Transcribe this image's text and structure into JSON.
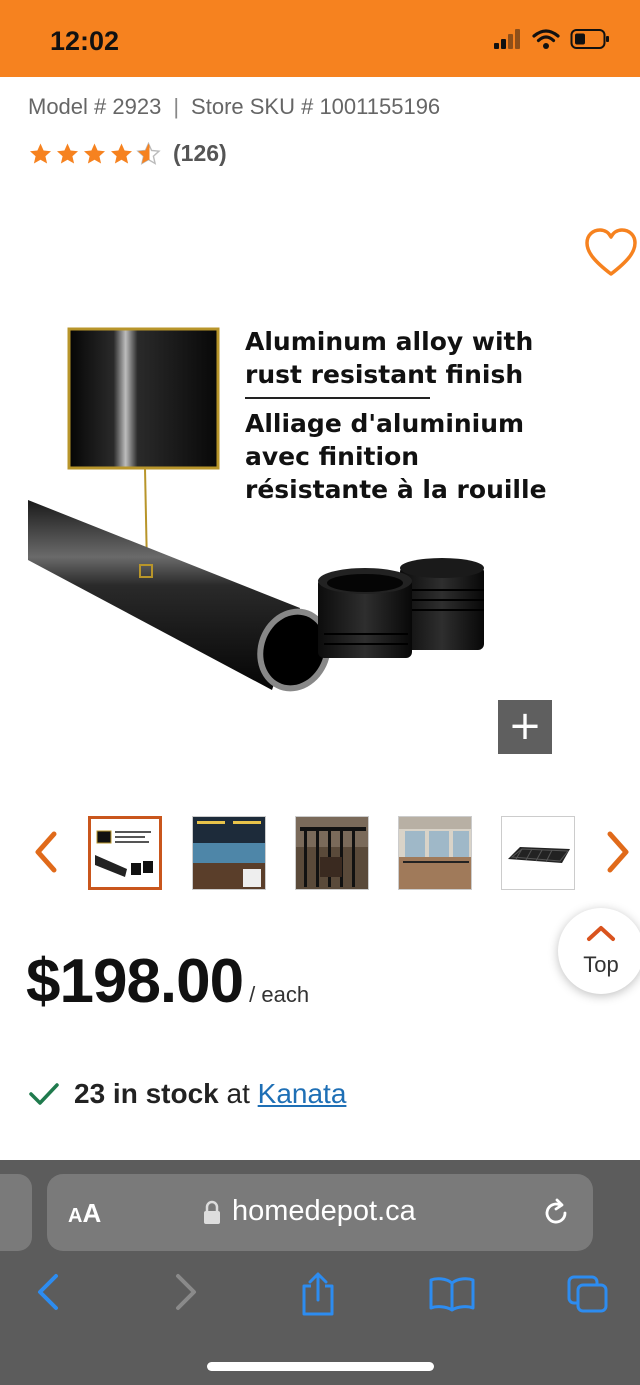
{
  "status_bar": {
    "time": "12:02"
  },
  "product": {
    "model_label": "Model # 2923",
    "sku_label": "Store SKU # 1001155196",
    "rating_value": 4.5,
    "review_count": "(126)",
    "image_text_en": "Aluminum alloy with\nrust resistant finish",
    "image_text_fr": "Alliage d'aluminium\navec finition\nrésistante à la rouille",
    "zoom_label": "+"
  },
  "thumbnails": {
    "count": 5,
    "active_index": 0
  },
  "pricing": {
    "amount": "$198.00",
    "unit": "/ each"
  },
  "back_to_top": {
    "label": "Top"
  },
  "stock": {
    "count_text": "23 in stock",
    "at_text": "at",
    "store": "Kanata"
  },
  "browser": {
    "aa_label_small": "A",
    "aa_label_large": "A",
    "url": "homedepot.ca"
  },
  "colors": {
    "brand_orange": "#f6821f",
    "accent_orange": "#c9561c",
    "link_blue": "#1e6fb5",
    "check_green": "#1f7a4d"
  }
}
